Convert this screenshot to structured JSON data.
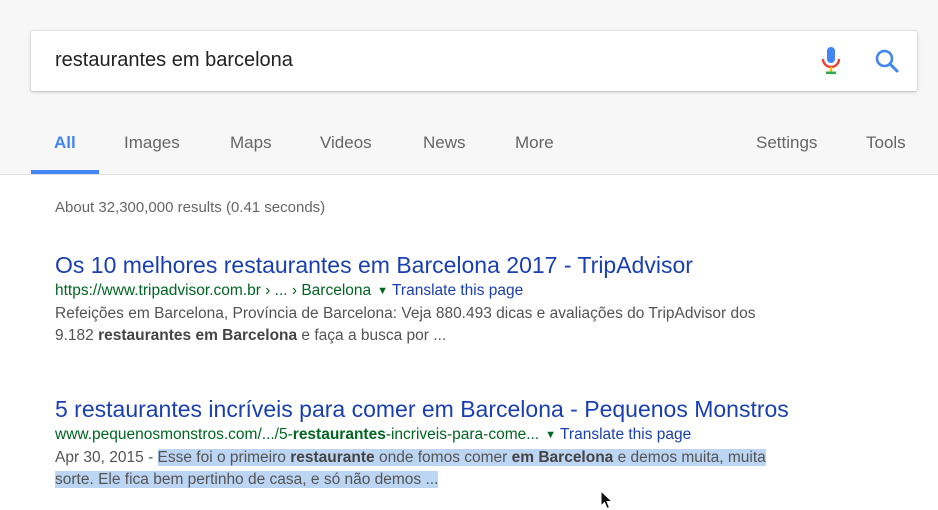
{
  "search": {
    "query": "restaurantes em barcelona"
  },
  "tabs": [
    {
      "label": "All"
    },
    {
      "label": "Images"
    },
    {
      "label": "Maps"
    },
    {
      "label": "Videos"
    },
    {
      "label": "News"
    },
    {
      "label": "More"
    },
    {
      "label": "Settings"
    },
    {
      "label": "Tools"
    }
  ],
  "result_stats": "About 32,300,000 results (0.41 seconds)",
  "results": [
    {
      "title": "Os 10 melhores restaurantes em Barcelona 2017 - TripAdvisor",
      "url": "https://www.tripadvisor.com.br › ... › Barcelona",
      "translate": "Translate this page",
      "snippet": {
        "line1": "Refeições em Barcelona, Província de Barcelona: Veja 880.493 dicas e avaliações do TripAdvisor dos",
        "line2_pre": "9.182 ",
        "line2_bold": "restaurantes em Barcelona",
        "line2_post": " e faça a busca por ..."
      }
    },
    {
      "title": "5 restaurantes incríveis para comer em Barcelona - Pequenos Monstros",
      "url_pre": "www.pequenosmonstros.com/.../5-",
      "url_bold": "restaurantes",
      "url_post": "-incriveis-para-come...",
      "translate": "Translate this page",
      "snippet": {
        "date": "Apr 30, 2015 - ",
        "s1": "Esse foi o primeiro ",
        "b1": "restaurante",
        "s2": " onde fomos comer ",
        "b2": "em Barcelona",
        "s3": " e demos muita, muita",
        "line2": "sorte. Ele fica bem pertinho de casa, e só não demos ..."
      }
    }
  ],
  "colors": {
    "link": "#1a3fb0",
    "url": "#006621",
    "snippet": "#545454",
    "active_tab": "#4285f4",
    "highlight": "#bcd5f3"
  },
  "icons": {
    "mic": "mic-icon",
    "search": "search-icon",
    "cursor": "mouse-cursor-icon"
  }
}
